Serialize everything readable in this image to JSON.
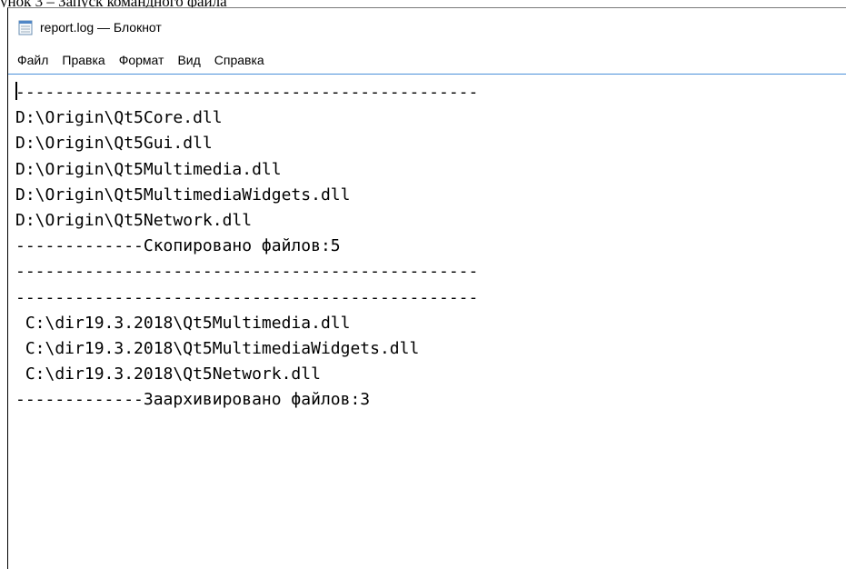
{
  "caption": "унок 3 – Запуск командного файла",
  "window": {
    "title": "report.log — Блокнот",
    "icon": "notepad-icon"
  },
  "menu": {
    "items": [
      "Файл",
      "Правка",
      "Формат",
      "Вид",
      "Справка"
    ]
  },
  "editor": {
    "lines": [
      "-----------------------------------------------",
      "D:\\Origin\\Qt5Core.dll",
      "D:\\Origin\\Qt5Gui.dll",
      "D:\\Origin\\Qt5Multimedia.dll",
      "D:\\Origin\\Qt5MultimediaWidgets.dll",
      "D:\\Origin\\Qt5Network.dll",
      "-------------Скопировано файлов:5",
      "-----------------------------------------------",
      "-----------------------------------------------",
      " C:\\dir19.3.2018\\Qt5Multimedia.dll",
      " C:\\dir19.3.2018\\Qt5MultimediaWidgets.dll",
      " C:\\dir19.3.2018\\Qt5Network.dll",
      "-------------Заархивировано файлов:3"
    ]
  }
}
